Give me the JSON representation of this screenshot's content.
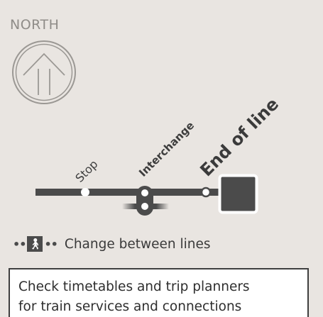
{
  "north": {
    "label": "NORTH"
  },
  "map_labels": {
    "stop": "Stop",
    "interchange": "Interchange",
    "end_of_line": "End of line"
  },
  "change_legend": {
    "text": "Change between lines",
    "icon": "pedestrian-icon"
  },
  "notice": {
    "line1": "Check timetables and trip planners",
    "line2": "for train services and connections"
  },
  "colors": {
    "background": "#e9e5e1",
    "line": "#4b4b4b",
    "north_grey": "#9b9894",
    "terminus": "#4b4b4b"
  }
}
